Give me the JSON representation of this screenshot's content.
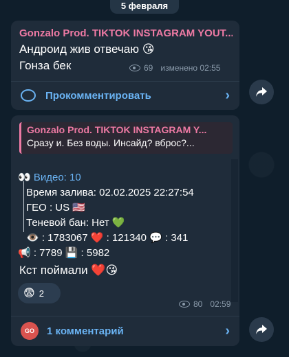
{
  "date_label": "5 февраля",
  "message1": {
    "author": "Gonzalo Prod. TIKTOK INSTAGRAM YOUT...",
    "line1": "Андроид жив отвечаю 😘",
    "line2": "Гонза бек",
    "views": "69",
    "edited_time": "изменено 02:55",
    "comment_label": "Прокомментировать"
  },
  "message2": {
    "quote_author": "Gonzalo Prod. TIKTOK INSTAGRAM Y...",
    "quote_text": "Сразу и. Без воды. Инсайд? вброс?...",
    "stats_header": "👀 Видео: 10",
    "stat_lines": [
      "Время залива: 02.02.2025 22:27:54",
      "ГЕО : US 🇺🇸",
      "Теневой бан: Нет 💚",
      "👁️ : 1783067 ❤️ : 121340  💬 : 341"
    ],
    "stat_last": "📢 : 7789 💾 : 5982",
    "body": "Кст поймали ❤️😘",
    "reaction_emoji": "😨",
    "reaction_count": "2",
    "views": "80",
    "time": "02:59",
    "avatar_initials": "GO",
    "comment_label": "1 комментарий"
  },
  "colors": {
    "author": "#ee7aa4",
    "link": "#6ab3f3",
    "bubble": "#1f2c3a",
    "background": "#0f1e2b"
  }
}
